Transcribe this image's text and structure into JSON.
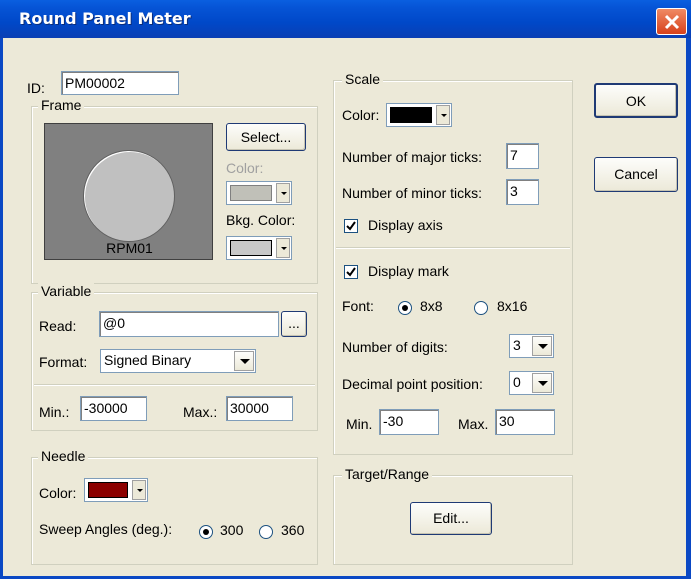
{
  "window": {
    "title": "Round Panel Meter"
  },
  "id_label": "ID:",
  "id_value": "PM00002",
  "frame": {
    "title": "Frame",
    "select_label": "Select...",
    "color_label": "Color:",
    "bkg_color_label": "Bkg. Color:",
    "preview_label": "RPM01",
    "color_value": "#c0c0b8",
    "bkg_color_value": "#c8c8c8"
  },
  "variable": {
    "title": "Variable",
    "read_label": "Read:",
    "read_value": "@0",
    "browse_label": "...",
    "format_label": "Format:",
    "format_value": "Signed Binary",
    "min_label": "Min.:",
    "min_value": "-30000",
    "max_label": "Max.:",
    "max_value": "30000"
  },
  "needle": {
    "title": "Needle",
    "color_label": "Color:",
    "color_value": "#8b0000",
    "sweep_label": "Sweep Angles (deg.):",
    "sweep_options": [
      "300",
      "360"
    ],
    "sweep_selected": "300"
  },
  "scale": {
    "title": "Scale",
    "color_label": "Color:",
    "color_value": "#000000",
    "major_ticks_label": "Number of major ticks:",
    "major_ticks_value": "7",
    "minor_ticks_label": "Number of minor ticks:",
    "minor_ticks_value": "3",
    "display_axis_label": "Display axis",
    "display_axis_checked": true,
    "display_mark_label": "Display mark",
    "display_mark_checked": true,
    "font_label": "Font:",
    "font_options": [
      "8x8",
      "8x16"
    ],
    "font_selected": "8x8",
    "digits_label": "Number of digits:",
    "digits_value": "3",
    "decimal_label": "Decimal point position:",
    "decimal_value": "0",
    "min_label": "Min.",
    "min_value": "-30",
    "max_label": "Max.",
    "max_value": "30"
  },
  "target": {
    "title": "Target/Range",
    "edit_label": "Edit..."
  },
  "buttons": {
    "ok": "OK",
    "cancel": "Cancel"
  }
}
